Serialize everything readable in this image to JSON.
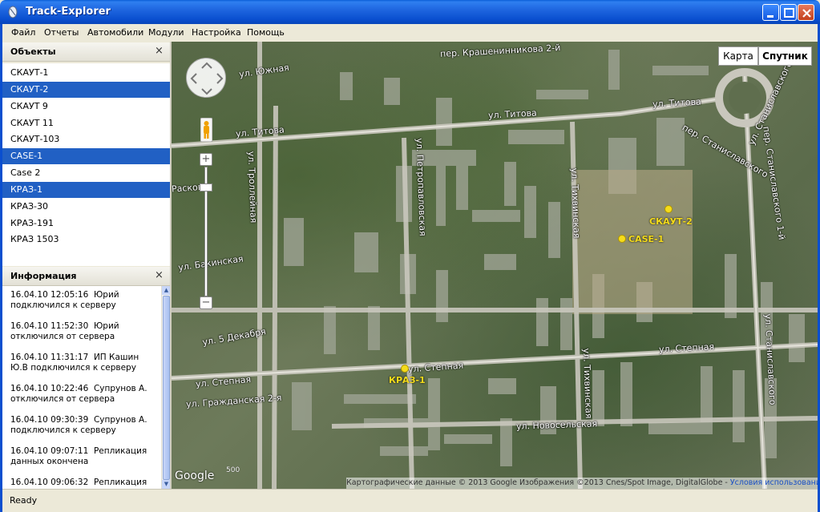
{
  "window": {
    "title": "Track-Explorer"
  },
  "menu": [
    "Файл",
    "Отчеты",
    "Автомобили",
    "Модули",
    "Настройка",
    "Помощь"
  ],
  "objects_panel": {
    "title": "Объекты",
    "close": "×",
    "items": [
      {
        "label": "СКАУТ-1",
        "selected": false
      },
      {
        "label": "СКАУТ-2",
        "selected": true
      },
      {
        "label": "СКАУТ 9",
        "selected": false
      },
      {
        "label": "СКАУТ 11",
        "selected": false
      },
      {
        "label": "СКАУТ-103",
        "selected": false
      },
      {
        "label": "CASE-1",
        "selected": true
      },
      {
        "label": "Case 2",
        "selected": false
      },
      {
        "label": "КРАЗ-1",
        "selected": true
      },
      {
        "label": "КРАЗ-30",
        "selected": false
      },
      {
        "label": "КРАЗ-191",
        "selected": false
      },
      {
        "label": "КРАЗ 1503",
        "selected": false
      }
    ]
  },
  "info_panel": {
    "title": "Информация",
    "close": "×",
    "entries": [
      {
        "time": "16.04.10 12:05:16",
        "text": "Юрий подключился к серверу"
      },
      {
        "time": "16.04.10 11:52:30",
        "text": "Юрий отключился от сервера"
      },
      {
        "time": "16.04.10 11:31:17",
        "text": "ИП Кашин Ю.В подключился к серверу"
      },
      {
        "time": "16.04.10 10:22:46",
        "text": "Супрунов А. отключился от сервера"
      },
      {
        "time": "16.04.10 09:30:39",
        "text": "Супрунов А. подключился к серверу"
      },
      {
        "time": "16.04.10 09:07:11",
        "text": "Репликация данных окончена"
      },
      {
        "time": "16.04.10 09:06:32",
        "text": "Репликация"
      }
    ]
  },
  "map": {
    "type_buttons": {
      "map": "Карта",
      "satellite": "Спутник"
    },
    "active_type": "satellite",
    "streets": {
      "yuzhnaya": "ул. Южная",
      "krasheninnikova": "пер. Крашенинникова 2-й",
      "titova_left": "ул. Титова",
      "titova_mid": "ул. Титова",
      "titova_right": "ул. Титова",
      "stanislavskogo_per": "пер. Станиславского",
      "stanislavskogo_ul": "ул. Станиславского",
      "stanislavskogo_bottom": "ул. Станиславского",
      "stanislavskogo_per_1": "пер. Станиславского 1-й",
      "trolleynaya": "ул. Троллейная",
      "petropavlovskaya": "ул. Петропавловская",
      "tikhvinskaya_top": "ул. Тихвинская",
      "tikhvinskaya_bottom": "ул. Тихвинская",
      "stepnaya_left": "ул. Степная",
      "stepnaya_mid": "ул. Степная",
      "stepnaya_right": "ул. Степная",
      "grazhdanskaya": "ул. Гражданская 2-я",
      "dekabrya": "ул. 5 Декабря",
      "bakinskaya": "ул. Бакинская",
      "raskovoy": "Расково",
      "novoselskaya": "ул. Новосельская"
    },
    "markers": [
      {
        "label": "СКАУТ-2",
        "color": "#f5dc1a"
      },
      {
        "label": "CASE-1",
        "color": "#f5dc1a"
      },
      {
        "label": "КРАЗ-1",
        "color": "#f5dc1a"
      }
    ],
    "controls": {
      "zoom_in": "+",
      "zoom_out": "−"
    },
    "logo": "Google",
    "scale_text": "500",
    "attribution": "Картографические данные © 2013 Google Изображения ©2013 Cnes/Spot Image, DigitalGlobe -",
    "terms": "Условия использования"
  },
  "status": {
    "text": "Ready"
  }
}
